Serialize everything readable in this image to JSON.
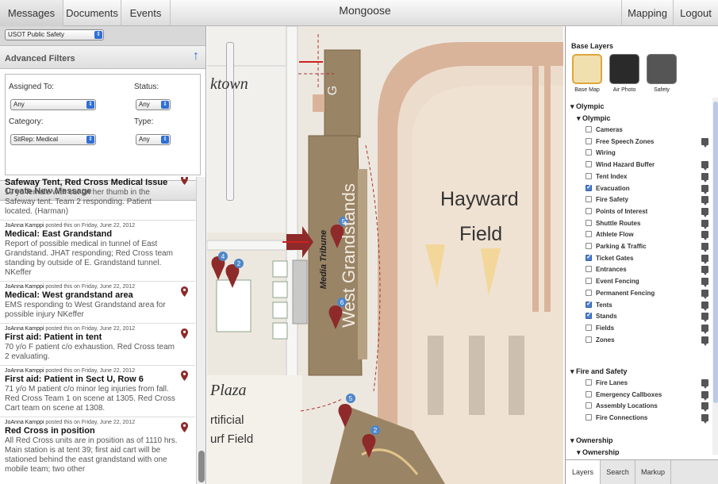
{
  "topbar": {
    "tabs": [
      "Messages",
      "Documents",
      "Events"
    ],
    "app_title": "Mongoose",
    "right_tabs": [
      "Mapping",
      "Logout"
    ]
  },
  "left": {
    "org_select": "USOT Public Safety",
    "advanced_filters": "Advanced Filters",
    "filters": {
      "assigned_label": "Assigned To:",
      "assigned_value": "Any",
      "status_label": "Status:",
      "status_value": "Any",
      "category_label": "Category:",
      "category_value": "SitRep: Medical",
      "type_label": "Type:",
      "type_value": "Any"
    },
    "create_new": "Create New Message",
    "messages": [
      {
        "meta_name": "",
        "meta_rest": "",
        "subject": "Safeway Tent, Red Cross Medical Issue",
        "body": "19 yo female with cut on her thumb in the Safeway tent. Team 2 responding.  Patient located. (Harman)"
      },
      {
        "meta_name": "JoAnna Kamppi",
        "meta_rest": " posted this on Friday, June 22, 2012",
        "subject": "Medical: East Grandstand",
        "body": "Report of possible medical in tunnel of East Grandstand. JHAT responding; Red Cross team standing by outside of E. Grandstand tunnel. NKeffer"
      },
      {
        "meta_name": "JoAnna Kamppi",
        "meta_rest": " posted this on Friday, June 22, 2012",
        "subject": "Medical: West grandstand area",
        "body": "EMS responding to West Grandstand area for possible injury NKeffer"
      },
      {
        "meta_name": "JoAnna Kamppi",
        "meta_rest": " posted this on Friday, June 22, 2012",
        "subject": "First aid: Patient in tent",
        "body": "70 y/o F patient c/o exhaustion. Red Cross team 2 evaluating."
      },
      {
        "meta_name": "JoAnna Kamppi",
        "meta_rest": " posted this on Friday, June 22, 2012",
        "subject": "First aid: Patient in Sect U, Row 6",
        "body": "71 y/o M patient c/o minor leg injuries from fall. Red Cross Team 1 on scene at 1305. Red Cross Cart team on scene at 1308."
      },
      {
        "meta_name": "JoAnna Kamppi",
        "meta_rest": " posted this on Friday, June 22, 2012",
        "subject": "Red Cross in position",
        "body": "All Red Cross units are in position as of 1110 hrs. Main station is at tent 39; first aid cart will be stationed behind the east grandstand with one mobile team; two other"
      }
    ]
  },
  "map": {
    "labels": {
      "ktown": "ktown",
      "hayward": "Hayward",
      "field": "Field",
      "g": "G",
      "west_grandstands": "West Grandstands",
      "media_tribune": "Media Tribune",
      "plaza": "Plaza",
      "artificial": "rtificial",
      "turf_field": "urf Field"
    },
    "markers": [
      "4",
      "2",
      "5",
      "6",
      "5",
      "2"
    ]
  },
  "right": {
    "base_layers_title": "Base Layers",
    "base_layers": [
      "Base Map",
      "Air Photo",
      "Safety"
    ],
    "group_olympic": "Olympic",
    "subgroup_olympic": "Olympic",
    "olympic_layers": [
      {
        "label": "Cameras",
        "checked": false,
        "legend": false
      },
      {
        "label": "Free Speech Zones",
        "checked": false,
        "legend": true
      },
      {
        "label": "Wiring",
        "checked": false,
        "legend": false
      },
      {
        "label": "Wind Hazard Buffer",
        "checked": false,
        "legend": true
      },
      {
        "label": "Tent Index",
        "checked": false,
        "legend": true
      },
      {
        "label": "Evacuation",
        "checked": true,
        "legend": true
      },
      {
        "label": "Fire Safety",
        "checked": false,
        "legend": true
      },
      {
        "label": "Points of Interest",
        "checked": false,
        "legend": true
      },
      {
        "label": "Shuttle Routes",
        "checked": false,
        "legend": true
      },
      {
        "label": "Athlete Flow",
        "checked": false,
        "legend": true
      },
      {
        "label": "Parking & Traffic",
        "checked": false,
        "legend": true
      },
      {
        "label": "Ticket Gates",
        "checked": true,
        "legend": true
      },
      {
        "label": "Entrances",
        "checked": false,
        "legend": true
      },
      {
        "label": "Event Fencing",
        "checked": false,
        "legend": true
      },
      {
        "label": "Permanent Fencing",
        "checked": false,
        "legend": true
      },
      {
        "label": "Tents",
        "checked": true,
        "legend": true
      },
      {
        "label": "Stands",
        "checked": true,
        "legend": true
      },
      {
        "label": "Fields",
        "checked": false,
        "legend": true
      },
      {
        "label": "Zones",
        "checked": false,
        "legend": true
      }
    ],
    "group_fire": "Fire and Safety",
    "fire_layers": [
      {
        "label": "Fire Lanes",
        "checked": false,
        "legend": true
      },
      {
        "label": "Emergency Callboxes",
        "checked": false,
        "legend": true
      },
      {
        "label": "Assembly Locations",
        "checked": false,
        "legend": true
      },
      {
        "label": "Fire Connections",
        "checked": false,
        "legend": true
      }
    ],
    "group_ownership": "Ownership",
    "subgroup_ownership": "Ownership",
    "bottom_tabs": [
      "Layers",
      "Search",
      "Markup"
    ]
  },
  "colors": {
    "accent": "#2f6fd6",
    "marker": "#8e2a2a",
    "grandstand": "#9a8466",
    "track": "#d4aa8e",
    "field_green": "#eee0cf"
  }
}
